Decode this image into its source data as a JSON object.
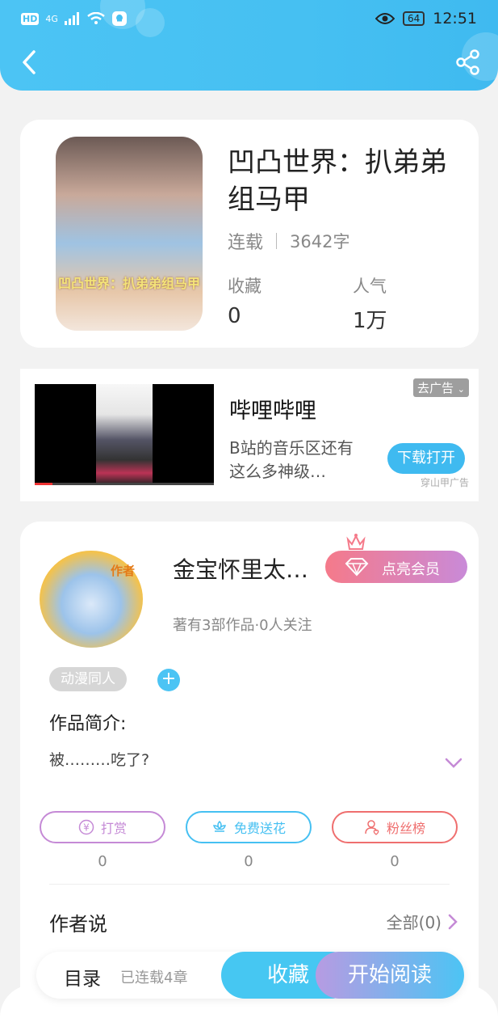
{
  "status_bar": {
    "network": "4G",
    "hd": "HD",
    "battery": "64",
    "time": "12:51"
  },
  "book": {
    "cover_text": "凹凸世界：扒弟弟组马甲",
    "title": "凹凸世界：扒弟弟组马甲",
    "status": "连载",
    "word_count": "3642字",
    "stats": [
      {
        "label": "收藏",
        "value": "0"
      },
      {
        "label": "人气",
        "value": "1万"
      }
    ]
  },
  "ad": {
    "title": "哔哩哔哩",
    "description": "B站的音乐区还有这么多神级…",
    "close_label": "去广告",
    "download_label": "下载打开",
    "source": "穿山甲广告"
  },
  "author": {
    "avatar_tag": "作者",
    "name": "金宝怀里太…",
    "vip_label": "点亮会员",
    "stats": "著有3部作品·0人关注",
    "tag": "动漫同人",
    "add_tag": "+",
    "intro_label": "作品简介:",
    "intro_text": "被………吃了?",
    "actions": [
      {
        "label": "打赏",
        "count": "0",
        "color": "#c58ad6",
        "icon": "yuan-icon"
      },
      {
        "label": "免费送花",
        "count": "0",
        "color": "#46c0f2",
        "icon": "flower-icon"
      },
      {
        "label": "粉丝榜",
        "count": "0",
        "color": "#ef6f6f",
        "icon": "fan-user-icon"
      }
    ],
    "author_say": "作者说",
    "view_all": "全部(0)"
  },
  "bottom_bar": {
    "toc": "目录",
    "chapters": "已连载4章",
    "favorite": "收藏",
    "read": "开始阅读"
  },
  "colors": {
    "accent": "#46c0f2",
    "vip_gradient_start": "#f57a8a",
    "vip_gradient_end": "#c98ad8"
  }
}
